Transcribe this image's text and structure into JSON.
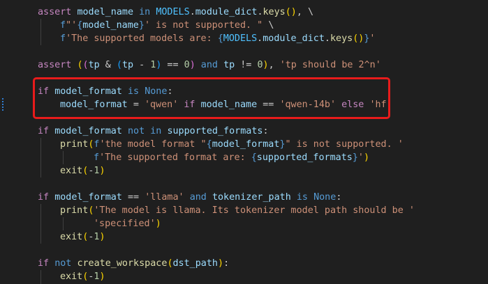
{
  "editor": {
    "lines": [
      [
        [
          "kw",
          "assert "
        ],
        [
          "id",
          "model_name "
        ],
        [
          "bkw",
          "in "
        ],
        [
          "cls",
          "MODELS"
        ],
        [
          "pl",
          "."
        ],
        [
          "id",
          "module_dict"
        ],
        [
          "pl",
          "."
        ],
        [
          "fn",
          "keys"
        ],
        [
          "br1",
          "()"
        ],
        [
          "pl",
          ", \\"
        ]
      ],
      [
        [
          "bkw",
          "f"
        ],
        [
          "str",
          "\"'"
        ],
        [
          "bkw",
          "{"
        ],
        [
          "id",
          "model_name"
        ],
        [
          "bkw",
          "}"
        ],
        [
          "str",
          "' is not supported. \" "
        ],
        [
          "pl",
          "\\"
        ]
      ],
      [
        [
          "bkw",
          "f"
        ],
        [
          "str",
          "'The supported models are: "
        ],
        [
          "bkw",
          "{"
        ],
        [
          "cls",
          "MODELS"
        ],
        [
          "pl",
          "."
        ],
        [
          "id",
          "module_dict"
        ],
        [
          "pl",
          "."
        ],
        [
          "fn",
          "keys"
        ],
        [
          "br1",
          "()"
        ],
        [
          "bkw",
          "}"
        ],
        [
          "str",
          "'"
        ]
      ],
      [],
      [
        [
          "kw",
          "assert "
        ],
        [
          "br1",
          "("
        ],
        [
          "br2",
          "("
        ],
        [
          "id",
          "tp "
        ],
        [
          "pl",
          "& "
        ],
        [
          "br3",
          "("
        ],
        [
          "id",
          "tp "
        ],
        [
          "pl",
          "- "
        ],
        [
          "num",
          "1"
        ],
        [
          "br3",
          ")"
        ],
        [
          "pl",
          " == "
        ],
        [
          "num",
          "0"
        ],
        [
          "br2",
          ")"
        ],
        [
          "bkw",
          " and "
        ],
        [
          "id",
          "tp "
        ],
        [
          "pl",
          "!= "
        ],
        [
          "num",
          "0"
        ],
        [
          "br1",
          ")"
        ],
        [
          "pl",
          ", "
        ],
        [
          "str",
          "'tp should be 2^n'"
        ]
      ],
      [],
      [
        [
          "kw",
          "if "
        ],
        [
          "id",
          "model_format "
        ],
        [
          "bkw",
          "is "
        ],
        [
          "bkw",
          "None"
        ],
        [
          "pl",
          ":"
        ]
      ],
      [
        [
          "id",
          "model_format "
        ],
        [
          "pl",
          "= "
        ],
        [
          "str",
          "'qwen' "
        ],
        [
          "kw",
          "if "
        ],
        [
          "id",
          "model_name "
        ],
        [
          "pl",
          "== "
        ],
        [
          "str",
          "'qwen-14b' "
        ],
        [
          "kw",
          "else "
        ],
        [
          "str",
          "'hf'"
        ]
      ],
      [],
      [
        [
          "kw",
          "if "
        ],
        [
          "id",
          "model_format "
        ],
        [
          "bkw",
          "not in "
        ],
        [
          "id",
          "supported_formats"
        ],
        [
          "pl",
          ":"
        ]
      ],
      [
        [
          "fn",
          "print"
        ],
        [
          "br1",
          "("
        ],
        [
          "bkw",
          "f"
        ],
        [
          "str",
          "'the model format \""
        ],
        [
          "bkw",
          "{"
        ],
        [
          "id",
          "model_format"
        ],
        [
          "bkw",
          "}"
        ],
        [
          "str",
          "\" is not supported. '"
        ]
      ],
      [
        [
          "bkw",
          "f"
        ],
        [
          "str",
          "'The supported format are: "
        ],
        [
          "bkw",
          "{"
        ],
        [
          "id",
          "supported_formats"
        ],
        [
          "bkw",
          "}"
        ],
        [
          "str",
          "'"
        ],
        [
          "br1",
          ")"
        ]
      ],
      [
        [
          "fn",
          "exit"
        ],
        [
          "br1",
          "("
        ],
        [
          "pl",
          "-"
        ],
        [
          "num",
          "1"
        ],
        [
          "br1",
          ")"
        ]
      ],
      [],
      [
        [
          "kw",
          "if "
        ],
        [
          "id",
          "model_format "
        ],
        [
          "pl",
          "== "
        ],
        [
          "str",
          "'llama' "
        ],
        [
          "bkw",
          "and "
        ],
        [
          "id",
          "tokenizer_path "
        ],
        [
          "bkw",
          "is "
        ],
        [
          "bkw",
          "None"
        ],
        [
          "pl",
          ":"
        ]
      ],
      [
        [
          "fn",
          "print"
        ],
        [
          "br1",
          "("
        ],
        [
          "str",
          "'The model is llama. Its tokenizer model path should be '"
        ]
      ],
      [
        [
          "str",
          "'specified'"
        ],
        [
          "br1",
          ")"
        ]
      ],
      [
        [
          "fn",
          "exit"
        ],
        [
          "br1",
          "("
        ],
        [
          "pl",
          "-"
        ],
        [
          "num",
          "1"
        ],
        [
          "br1",
          ")"
        ]
      ],
      [],
      [
        [
          "kw",
          "if "
        ],
        [
          "bkw",
          "not "
        ],
        [
          "fn",
          "create_workspace"
        ],
        [
          "br1",
          "("
        ],
        [
          "id",
          "dst_path"
        ],
        [
          "br1",
          ")"
        ],
        [
          "pl",
          ":"
        ]
      ],
      [
        [
          "fn",
          "exit"
        ],
        [
          "br1",
          "("
        ],
        [
          "pl",
          "-"
        ],
        [
          "num",
          "1"
        ],
        [
          "br1",
          ")"
        ]
      ]
    ]
  },
  "annotation": {
    "highlight_color": "#e81b1b"
  },
  "colors": {
    "background": "#1f1f1f",
    "keyword": "#c586c0",
    "builtin_keyword": "#569cd6",
    "variable": "#9cdcfe",
    "constant": "#4fc1ff",
    "function": "#dcdcaa",
    "string": "#ce9178",
    "number": "#b5cea8"
  }
}
